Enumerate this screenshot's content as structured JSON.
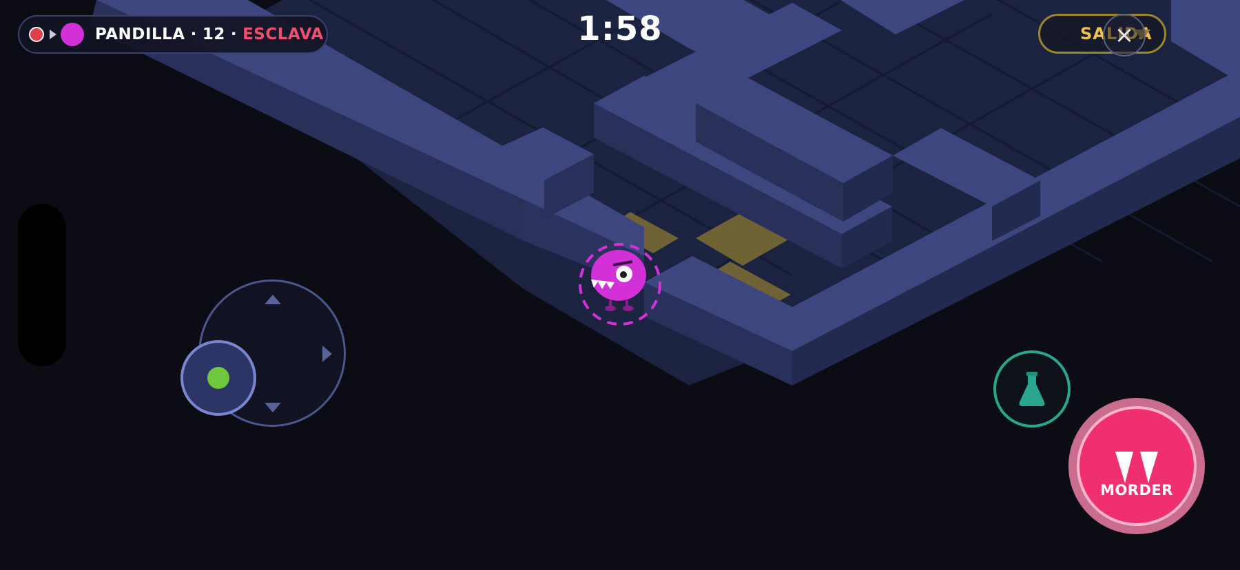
{
  "hud": {
    "team_label": "PANDILLA",
    "separator": "·",
    "count": "12",
    "role": "ESCLAVA",
    "colors": {
      "red_player": "#e0404a",
      "magenta_player": "#d231d8",
      "role": "#f0506e"
    }
  },
  "timer": {
    "value": "1:58"
  },
  "exit": {
    "label": "SALIDA",
    "close_icon": "×"
  },
  "controls": {
    "joystick": {
      "knob_color": "#6fc63f"
    },
    "potion": {
      "icon": "flask-icon",
      "color": "#2aa58f"
    },
    "bite": {
      "label": "MORDER",
      "icon": "fangs-icon",
      "color": "#f0306e"
    }
  },
  "character": {
    "name_icon": "monster-icon",
    "color": "#d231d8"
  },
  "colors": {
    "background": "#0c0c14",
    "wall_top": "#3a437a",
    "floor": "#1e2540",
    "goal_tile": "#6f6234"
  }
}
